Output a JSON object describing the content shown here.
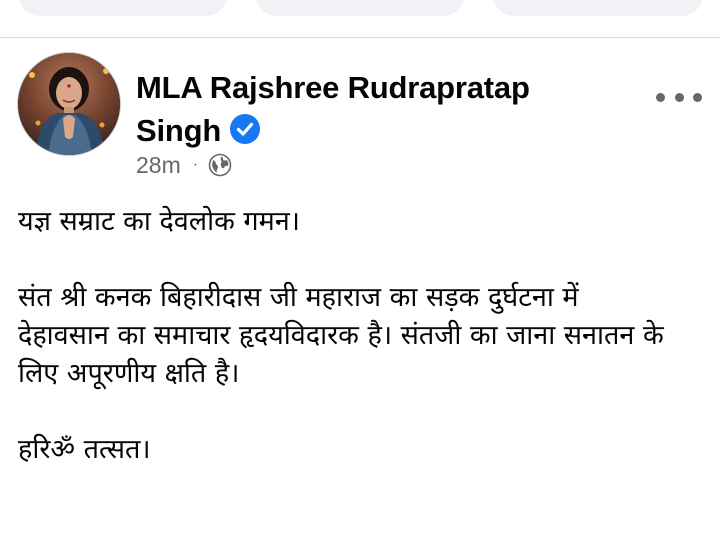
{
  "top_pills": [
    "",
    "",
    ""
  ],
  "post": {
    "author": "MLA Rajshree Rudrapratap Singh",
    "time": "28m",
    "separator": "·",
    "audience_icon": "globe-icon",
    "verified_icon": "verified-badge-icon",
    "more_icon": "more-options-icon",
    "paragraphs": [
      "यज्ञ सम्राट का देवलोक गमन।",
      "संत श्री कनक बिहारीदास जी महाराज का सड़क दुर्घटना में देहावसान का समाचार हृदयविदारक है। संतजी का जाना सनातन के लिए अपूरणीय क्षति है।",
      "हरिॐ तत्सत।"
    ]
  },
  "colors": {
    "verified_blue": "#1877f2",
    "secondary_text": "#65676b",
    "primary_text": "#050505",
    "pill_bg": "#f0f2f5"
  }
}
